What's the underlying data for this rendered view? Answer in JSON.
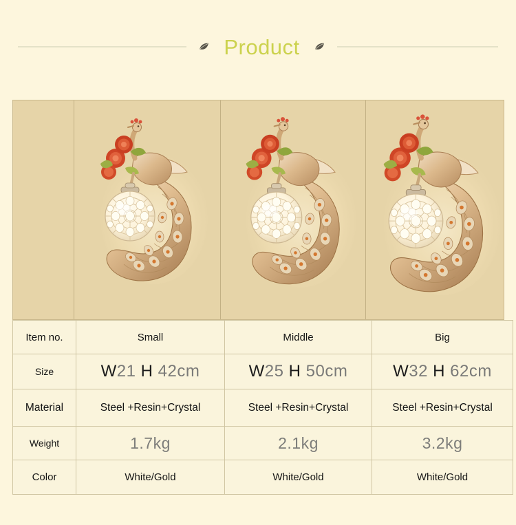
{
  "header": {
    "title": "Product",
    "left_leaf_icon": "leaf-icon",
    "right_leaf_icon": "leaf-icon"
  },
  "gallery": {
    "background_color": "#e6d4a8",
    "items": [
      {
        "name": "peacock-wall-lamp-small",
        "alt": "Small peacock crystal wall lamp"
      },
      {
        "name": "peacock-wall-lamp-middle",
        "alt": "Middle peacock crystal wall lamp"
      },
      {
        "name": "peacock-wall-lamp-big",
        "alt": "Big peacock crystal wall lamp"
      }
    ]
  },
  "spec_table": {
    "rows": [
      {
        "label": "Item no.",
        "kind": "text",
        "values": [
          "Small",
          "Middle",
          "Big"
        ]
      },
      {
        "label": "Size",
        "kind": "size",
        "values": [
          {
            "w_mark": "W",
            "w_num": "21",
            "h_mark": "H",
            "h_num": "42cm"
          },
          {
            "w_mark": "W",
            "w_num": "25",
            "h_mark": "H",
            "h_num": "50cm"
          },
          {
            "w_mark": "W",
            "w_num": "32",
            "h_mark": "H",
            "h_num": "62cm"
          }
        ]
      },
      {
        "label": "Material",
        "kind": "text",
        "values": [
          "Steel +Resin+Crystal",
          "Steel +Resin+Crystal",
          "Steel +Resin+Crystal"
        ]
      },
      {
        "label": "Weight",
        "kind": "weight",
        "values": [
          "1.7kg",
          "2.1kg",
          "3.2kg"
        ]
      },
      {
        "label": "Color",
        "kind": "text",
        "values": [
          "White/Gold",
          "White/Gold",
          "White/Gold"
        ]
      }
    ]
  },
  "colors": {
    "page_background": "#fdf6dd",
    "title": "#ccd24e",
    "rule": "#e4e2c8",
    "strip_background": "#e6d4a8",
    "table_background": "#faf4dc",
    "table_border": "#cfc5a2",
    "text": "#141414",
    "muted_text": "#7d7d7a"
  }
}
